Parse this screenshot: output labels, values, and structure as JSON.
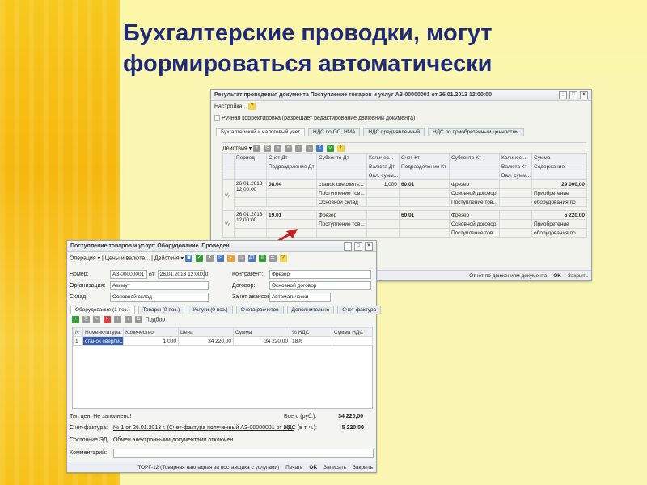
{
  "slide": {
    "title_line1": "Бухгалтерские проводки, могут",
    "title_line2": "формироваться автоматически"
  },
  "result_window": {
    "title": "Результат проведения документа Поступление товаров и услуг АЗ-00000001 от 26.01.2013 12:00:00",
    "settings": "Настройка...",
    "manual_checkbox": "Ручная корректировка (разрешает редактирование движений документа)",
    "tabs": [
      "Бухгалтерский и налоговый учет",
      "НДС по ОС, НМА",
      "НДС предъявленный",
      "НДС по приобретенным ценностям"
    ],
    "actions": "Действия",
    "headers": {
      "period": "Период",
      "debit": "Счет Дт",
      "subconto_dt": "Субконто Дт",
      "qty_dt": "Количес...",
      "credit": "Счет Кт",
      "subconto_kt": "Субконто Кт",
      "qty_kt": "Количес...",
      "sum": "Сумма",
      "dept_dt": "Подразделение Дт",
      "currency_dt": "Валюта Дт",
      "dept_kt": "Подразделение Кт",
      "currency_kt": "Валюта Кт",
      "content": "Содержание",
      "val_sum_dt": "Вал. сумм...",
      "val_sum_kt": "Вал. сумм..."
    },
    "rows": [
      {
        "date": "26.01.2013",
        "time": "12:00:00",
        "debit": "08.04",
        "sub_dt_1": "станок сверлиль...",
        "sub_dt_2": "Поступление тов...",
        "sub_dt_3": "Основной склад",
        "qty": "1,000",
        "credit": "60.01",
        "sub_kt_1": "Фрезер",
        "sub_kt_2": "Основной договор",
        "sub_kt_3": "Поступление тов...",
        "sum": "29 000,00",
        "content_1": "Приобретение",
        "content_2": "оборудования по"
      },
      {
        "date": "26.01.2013",
        "time": "12:00:00",
        "debit": "19.01",
        "sub_dt_1": "Фрезер",
        "sub_dt_2": "Поступление тов...",
        "credit": "60.01",
        "sub_kt_1": "Фрезер",
        "sub_kt_2": "Основной договор",
        "sub_kt_3": "Поступление тов...",
        "sum": "5 220,00",
        "content_1": "Приобретение",
        "content_2": "оборудования по"
      }
    ],
    "footer": {
      "report": "Отчет по движениям документа",
      "ok": "OK",
      "close": "Закрыть"
    }
  },
  "doc_window": {
    "title": "Поступление товаров и услуг: Оборудование. Проведен",
    "toolbar": {
      "operation": "Операция",
      "prices": "Цены и валюта...",
      "actions": "Действия"
    },
    "labels": {
      "number": "Номер:",
      "from": "от:",
      "org": "Организация:",
      "warehouse": "Склад:",
      "counterparty": "Контрагент:",
      "contract": "Договор:",
      "advance": "Зачет авансов:"
    },
    "values": {
      "number": "АЗ-00000001",
      "date": "26.01.2013 12:00:00",
      "org": "Азимут",
      "warehouse": "Основной склад",
      "counterparty": "Фрезер",
      "contract": "Основной договор",
      "advance": "Автоматически"
    },
    "tabs": [
      "Оборудование (1 поз.)",
      "Товары (0 поз.)",
      "Услуги (0 поз.)",
      "Счета расчетов",
      "Дополнительно",
      "Счет-фактура"
    ],
    "pick": "Подбор",
    "table_headers": [
      "N",
      "Номенклатура",
      "Количество",
      "Цена",
      "Сумма",
      "% НДС",
      "Сумма НДС"
    ],
    "table_row": [
      "1",
      "станок сверли...",
      "1,000",
      "34 220,00",
      "34 220,00",
      "18%",
      ""
    ],
    "price_type": "Тип цен: Не заполнено!",
    "total_label": "Всего (руб.):",
    "total_value": "34 220,00",
    "vat_label": "НДС (в т. ч.):",
    "vat_value": "5 220,00",
    "invoice_label": "Счет-фактура:",
    "invoice_value": "№ 1 от 26.01.2013 г. (Счет-фактура полученный АЗ-00000001 от 26...",
    "edo_label": "Состояние ЭД:",
    "edo_value": "Обмен электронными документами отключен",
    "comment_label": "Комментарий:",
    "footer": {
      "torg": "ТОРГ-12 (Товарная накладная за поставщика с услугами)",
      "print": "Печать",
      "ok": "OK",
      "write": "Записать",
      "close": "Закрыть"
    }
  },
  "colors": {
    "title": "#1d2a7a",
    "band": "#f5b80e",
    "background": "#fbf7b2",
    "arrow": "#cc1f1f"
  }
}
